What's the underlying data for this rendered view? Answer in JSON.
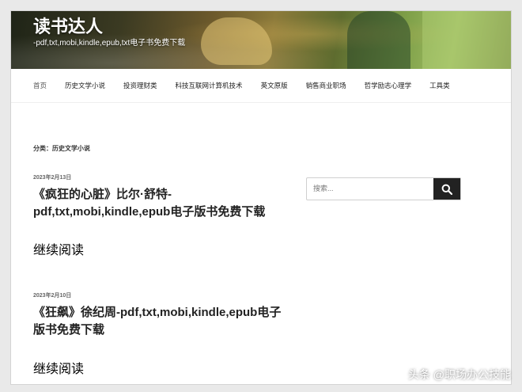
{
  "site": {
    "title": "读书达人",
    "description": "-pdf,txt,mobi,kindle,epub,txt电子书免费下载"
  },
  "nav": [
    {
      "label": "首页"
    },
    {
      "label": "历史文学小说"
    },
    {
      "label": "投资理财类"
    },
    {
      "label": "科技互联网计算机技术"
    },
    {
      "label": "英文原版"
    },
    {
      "label": "销售商业职场"
    },
    {
      "label": "哲学励志心理学"
    },
    {
      "label": "工具类"
    }
  ],
  "category": "分类：历史文学小说",
  "posts": [
    {
      "date": "2023年2月13日",
      "title": "《疯狂的心脏》比尔·舒特-pdf,txt,mobi,kindle,epub电子版书免费下载",
      "more": "继续阅读"
    },
    {
      "date": "2023年2月10日",
      "title": "《狂飙》徐纪周-pdf,txt,mobi,kindle,epub电子版书免费下载",
      "more": "继续阅读"
    }
  ],
  "search": {
    "placeholder": "搜索..."
  },
  "watermark": "头条 @职场办公技能"
}
